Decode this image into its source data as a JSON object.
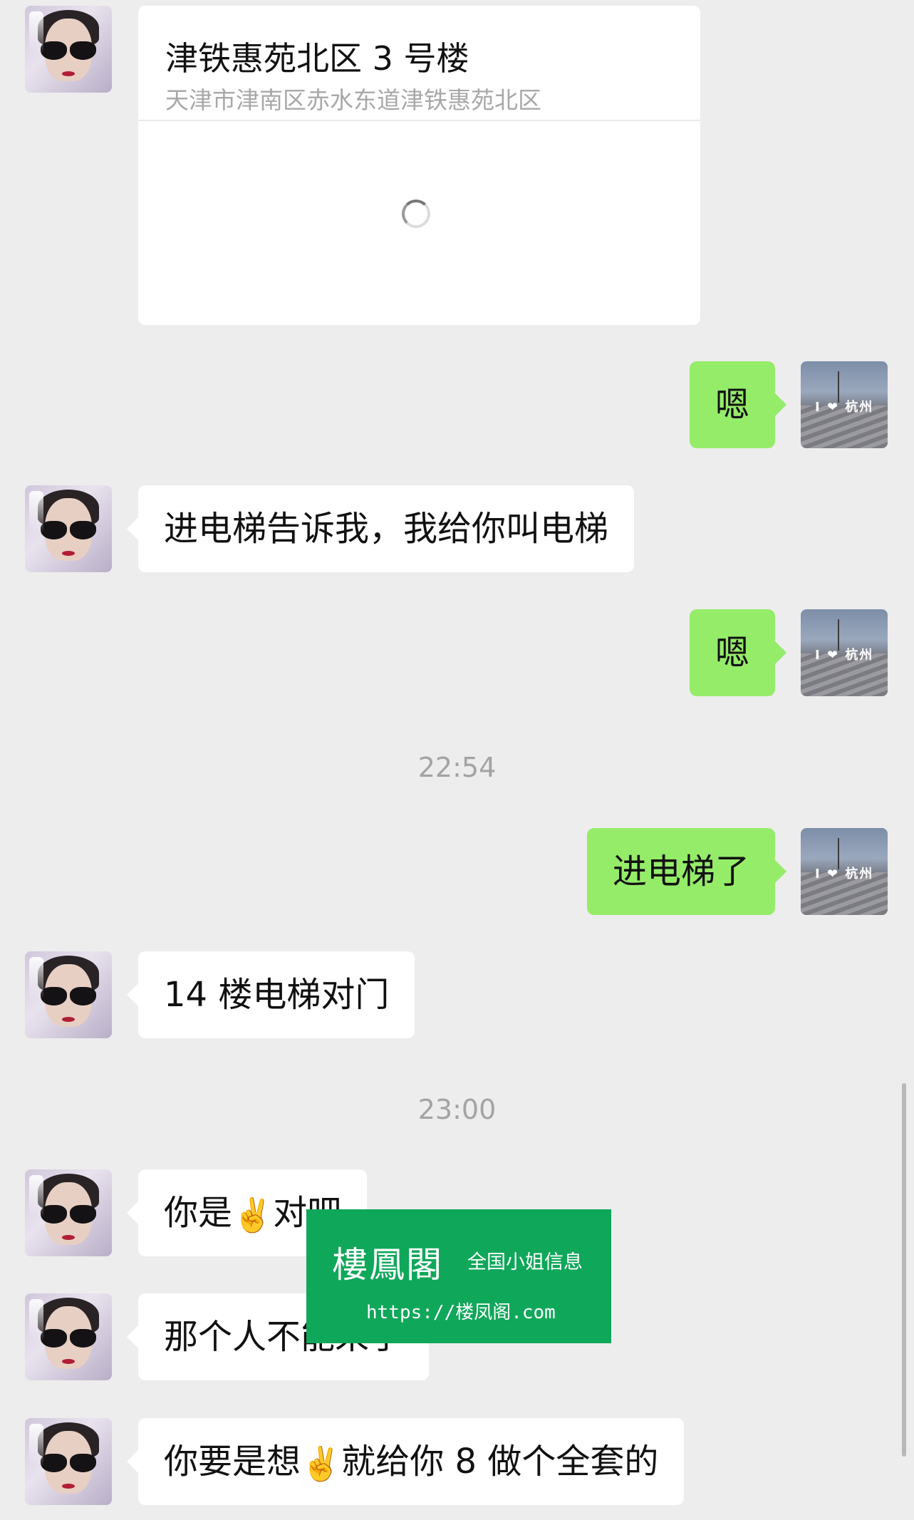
{
  "location_card": {
    "title": "津铁惠苑北区 3 号楼",
    "address": "天津市津南区赤水东道津铁惠苑北区"
  },
  "messages": [
    {
      "side": "right",
      "text": "嗯"
    },
    {
      "side": "left",
      "text": "进电梯告诉我，我给你叫电梯"
    },
    {
      "side": "right",
      "text": "嗯"
    },
    {
      "side": "right",
      "text": "进电梯了"
    },
    {
      "side": "left",
      "text": "14 楼电梯对门"
    },
    {
      "side": "left",
      "text_before": "你是",
      "emoji": "✌️",
      "text_after": "对吧"
    },
    {
      "side": "left",
      "text": "那个人不能来了"
    },
    {
      "side": "left",
      "text_before": "你要是想",
      "emoji": "✌️",
      "text_after": "就给你 8 做个全套的"
    }
  ],
  "timestamps": [
    "22:54",
    "23:00"
  ],
  "avatar_right_sign": "I ❤ 杭州",
  "watermark": {
    "name": "樓鳳閣",
    "tagline": "全国小姐信息",
    "url": "https://楼凤阁.com",
    "color": "#0fa75a"
  },
  "colors": {
    "background": "#ededed",
    "sent_bubble": "#95ec69",
    "received_bubble": "#ffffff"
  }
}
